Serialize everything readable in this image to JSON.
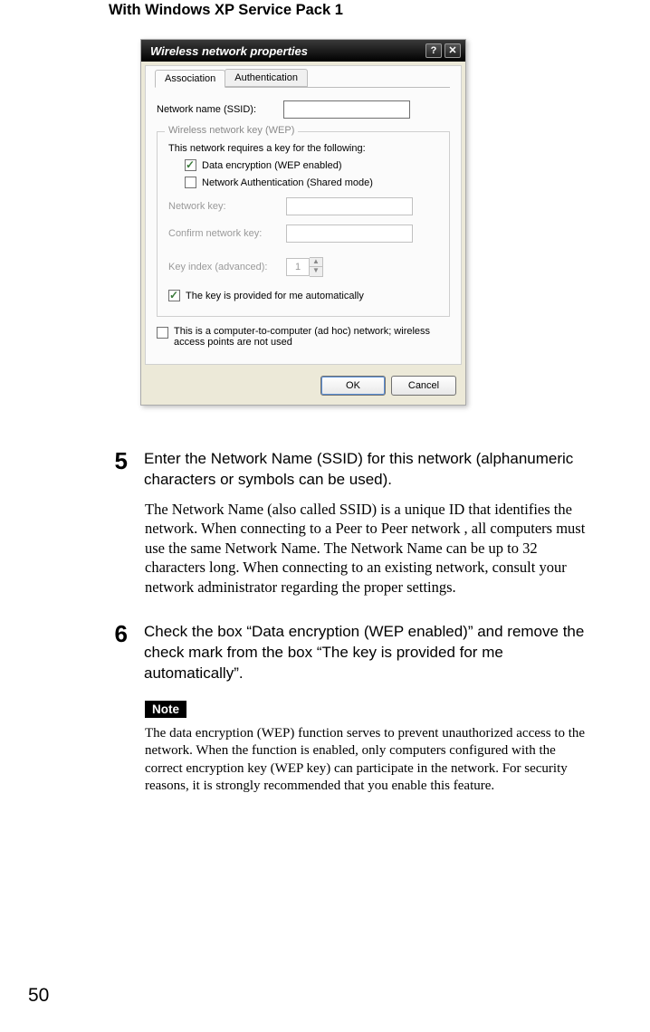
{
  "heading": "With Windows XP Service Pack 1",
  "dialog": {
    "title": "Wireless network properties",
    "help_btn": "?",
    "close_btn": "✕",
    "tabs": {
      "association": "Association",
      "authentication": "Authentication"
    },
    "ssid_label": "Network name (SSID):",
    "ssid_value": "",
    "wep_group_label": "Wireless network key (WEP)",
    "wep_requires_text": "This network requires a key for the following:",
    "chk_data_enc": "Data encryption (WEP enabled)",
    "chk_net_auth": "Network Authentication (Shared mode)",
    "netkey_label": "Network key:",
    "netkey_value": "",
    "confirm_label": "Confirm network key:",
    "confirm_value": "",
    "keyindex_label": "Key index (advanced):",
    "keyindex_value": "1",
    "chk_auto_key": "The key is provided for me automatically",
    "chk_adhoc": "This is a computer-to-computer (ad hoc) network; wireless access points are not used",
    "ok": "OK",
    "cancel": "Cancel"
  },
  "step5": {
    "num": "5",
    "title": "Enter the Network Name (SSID) for this network (alphanumeric characters or symbols can be used).",
    "body": "The Network Name (also called SSID) is a unique ID that identifies the network. When connecting to a Peer to Peer network , all computers must use the same Network Name. The Network Name can be up to 32 characters long. When connecting to an existing network, consult your network administrator regarding the proper settings."
  },
  "step6": {
    "num": "6",
    "title": "Check the box “Data encryption (WEP enabled)” and remove the check mark from the box “The key is provided for me automatically”.",
    "note_label": "Note",
    "note_body": "The data encryption (WEP) function serves to prevent unauthorized access to the network. When the function is enabled, only computers configured with the correct encryption key (WEP key) can participate in the network. For security reasons, it is strongly recommended that you enable this feature."
  },
  "page_number": "50"
}
